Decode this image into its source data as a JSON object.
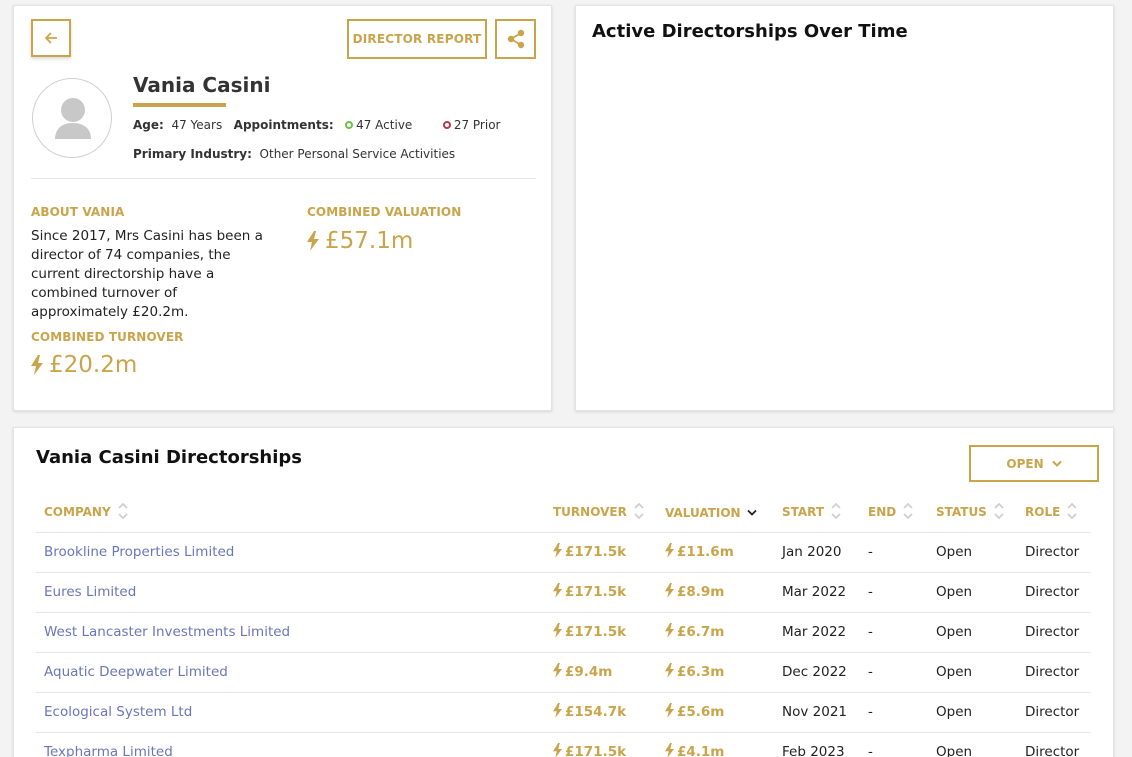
{
  "profile": {
    "report_label": "DIRECTOR REPORT",
    "name": "Vania Casini",
    "age_label": "Age:",
    "age_value": "47 Years",
    "appointments_label": "Appointments:",
    "active": "47 Active",
    "prior": "27 Prior",
    "industry_label": "Primary Industry:",
    "industry_value": "Other Personal Service Activities",
    "about_label": "ABOUT VANIA",
    "about_text": "Since 2017, Mrs Casini has been a director of 74 companies, the current directorship have a combined turnover of approximately £20.2m.",
    "valuation_label": "COMBINED VALUATION",
    "valuation_value": "£57.1m",
    "turnover_label": "COMBINED TURNOVER",
    "turnover_value": "£20.2m"
  },
  "chart": {
    "title": "Active Directorships Over Time"
  },
  "directorships": {
    "title": "Vania Casini Directorships",
    "filter_label": "OPEN",
    "columns": [
      "COMPANY",
      "TURNOVER",
      "VALUATION",
      "START",
      "END",
      "STATUS",
      "ROLE"
    ],
    "rows": [
      {
        "company": "Brookline Properties Limited",
        "turnover": "£171.5k",
        "valuation": "£11.6m",
        "start": "Jan 2020",
        "end": "-",
        "status": "Open",
        "role": "Director"
      },
      {
        "company": "Eures Limited",
        "turnover": "£171.5k",
        "valuation": "£8.9m",
        "start": "Mar 2022",
        "end": "-",
        "status": "Open",
        "role": "Director"
      },
      {
        "company": "West Lancaster Investments Limited",
        "turnover": "£171.5k",
        "valuation": "£6.7m",
        "start": "Mar 2022",
        "end": "-",
        "status": "Open",
        "role": "Director"
      },
      {
        "company": "Aquatic Deepwater Limited",
        "turnover": "£9.4m",
        "valuation": "£6.3m",
        "start": "Dec 2022",
        "end": "-",
        "status": "Open",
        "role": "Director"
      },
      {
        "company": "Ecological System Ltd",
        "turnover": "£154.7k",
        "valuation": "£5.6m",
        "start": "Nov 2021",
        "end": "-",
        "status": "Open",
        "role": "Director"
      },
      {
        "company": "Texpharma Limited",
        "turnover": "£171.5k",
        "valuation": "£4.1m",
        "start": "Feb 2023",
        "end": "-",
        "status": "Open",
        "role": "Director"
      }
    ]
  },
  "colors": {
    "accent": "#c9a44a",
    "link": "#6b76b8",
    "active_dot": "#6bbf4b",
    "prior_dot": "#b33a4a"
  }
}
